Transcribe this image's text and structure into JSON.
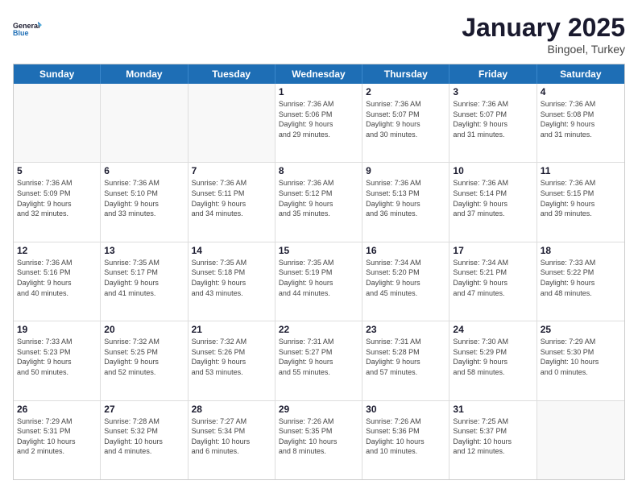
{
  "logo": {
    "line1": "General",
    "line2": "Blue"
  },
  "title": "January 2025",
  "subtitle": "Bingoel, Turkey",
  "headers": [
    "Sunday",
    "Monday",
    "Tuesday",
    "Wednesday",
    "Thursday",
    "Friday",
    "Saturday"
  ],
  "weeks": [
    [
      {
        "day": "",
        "info": ""
      },
      {
        "day": "",
        "info": ""
      },
      {
        "day": "",
        "info": ""
      },
      {
        "day": "1",
        "info": "Sunrise: 7:36 AM\nSunset: 5:06 PM\nDaylight: 9 hours\nand 29 minutes."
      },
      {
        "day": "2",
        "info": "Sunrise: 7:36 AM\nSunset: 5:07 PM\nDaylight: 9 hours\nand 30 minutes."
      },
      {
        "day": "3",
        "info": "Sunrise: 7:36 AM\nSunset: 5:07 PM\nDaylight: 9 hours\nand 31 minutes."
      },
      {
        "day": "4",
        "info": "Sunrise: 7:36 AM\nSunset: 5:08 PM\nDaylight: 9 hours\nand 31 minutes."
      }
    ],
    [
      {
        "day": "5",
        "info": "Sunrise: 7:36 AM\nSunset: 5:09 PM\nDaylight: 9 hours\nand 32 minutes."
      },
      {
        "day": "6",
        "info": "Sunrise: 7:36 AM\nSunset: 5:10 PM\nDaylight: 9 hours\nand 33 minutes."
      },
      {
        "day": "7",
        "info": "Sunrise: 7:36 AM\nSunset: 5:11 PM\nDaylight: 9 hours\nand 34 minutes."
      },
      {
        "day": "8",
        "info": "Sunrise: 7:36 AM\nSunset: 5:12 PM\nDaylight: 9 hours\nand 35 minutes."
      },
      {
        "day": "9",
        "info": "Sunrise: 7:36 AM\nSunset: 5:13 PM\nDaylight: 9 hours\nand 36 minutes."
      },
      {
        "day": "10",
        "info": "Sunrise: 7:36 AM\nSunset: 5:14 PM\nDaylight: 9 hours\nand 37 minutes."
      },
      {
        "day": "11",
        "info": "Sunrise: 7:36 AM\nSunset: 5:15 PM\nDaylight: 9 hours\nand 39 minutes."
      }
    ],
    [
      {
        "day": "12",
        "info": "Sunrise: 7:36 AM\nSunset: 5:16 PM\nDaylight: 9 hours\nand 40 minutes."
      },
      {
        "day": "13",
        "info": "Sunrise: 7:35 AM\nSunset: 5:17 PM\nDaylight: 9 hours\nand 41 minutes."
      },
      {
        "day": "14",
        "info": "Sunrise: 7:35 AM\nSunset: 5:18 PM\nDaylight: 9 hours\nand 43 minutes."
      },
      {
        "day": "15",
        "info": "Sunrise: 7:35 AM\nSunset: 5:19 PM\nDaylight: 9 hours\nand 44 minutes."
      },
      {
        "day": "16",
        "info": "Sunrise: 7:34 AM\nSunset: 5:20 PM\nDaylight: 9 hours\nand 45 minutes."
      },
      {
        "day": "17",
        "info": "Sunrise: 7:34 AM\nSunset: 5:21 PM\nDaylight: 9 hours\nand 47 minutes."
      },
      {
        "day": "18",
        "info": "Sunrise: 7:33 AM\nSunset: 5:22 PM\nDaylight: 9 hours\nand 48 minutes."
      }
    ],
    [
      {
        "day": "19",
        "info": "Sunrise: 7:33 AM\nSunset: 5:23 PM\nDaylight: 9 hours\nand 50 minutes."
      },
      {
        "day": "20",
        "info": "Sunrise: 7:32 AM\nSunset: 5:25 PM\nDaylight: 9 hours\nand 52 minutes."
      },
      {
        "day": "21",
        "info": "Sunrise: 7:32 AM\nSunset: 5:26 PM\nDaylight: 9 hours\nand 53 minutes."
      },
      {
        "day": "22",
        "info": "Sunrise: 7:31 AM\nSunset: 5:27 PM\nDaylight: 9 hours\nand 55 minutes."
      },
      {
        "day": "23",
        "info": "Sunrise: 7:31 AM\nSunset: 5:28 PM\nDaylight: 9 hours\nand 57 minutes."
      },
      {
        "day": "24",
        "info": "Sunrise: 7:30 AM\nSunset: 5:29 PM\nDaylight: 9 hours\nand 58 minutes."
      },
      {
        "day": "25",
        "info": "Sunrise: 7:29 AM\nSunset: 5:30 PM\nDaylight: 10 hours\nand 0 minutes."
      }
    ],
    [
      {
        "day": "26",
        "info": "Sunrise: 7:29 AM\nSunset: 5:31 PM\nDaylight: 10 hours\nand 2 minutes."
      },
      {
        "day": "27",
        "info": "Sunrise: 7:28 AM\nSunset: 5:32 PM\nDaylight: 10 hours\nand 4 minutes."
      },
      {
        "day": "28",
        "info": "Sunrise: 7:27 AM\nSunset: 5:34 PM\nDaylight: 10 hours\nand 6 minutes."
      },
      {
        "day": "29",
        "info": "Sunrise: 7:26 AM\nSunset: 5:35 PM\nDaylight: 10 hours\nand 8 minutes."
      },
      {
        "day": "30",
        "info": "Sunrise: 7:26 AM\nSunset: 5:36 PM\nDaylight: 10 hours\nand 10 minutes."
      },
      {
        "day": "31",
        "info": "Sunrise: 7:25 AM\nSunset: 5:37 PM\nDaylight: 10 hours\nand 12 minutes."
      },
      {
        "day": "",
        "info": ""
      }
    ]
  ]
}
